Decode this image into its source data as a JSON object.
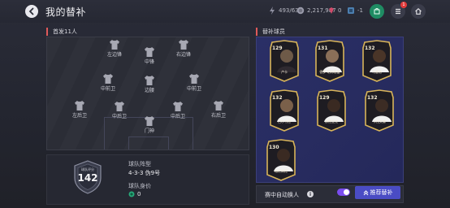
{
  "header": {
    "title": "我的替补",
    "resources": [
      {
        "name": "energy",
        "icon": "bolt-icon",
        "value": "493/63"
      },
      {
        "name": "coins",
        "icon": "coin-icon",
        "value": "2,217,987"
      },
      {
        "name": "gems",
        "icon": "gem-icon",
        "value": "0"
      },
      {
        "name": "fc-points",
        "icon": "fc-points-icon",
        "value": "-1"
      }
    ],
    "notification_count": "1"
  },
  "starting": {
    "title": "首发11人",
    "positions": {
      "lw": "左边锋",
      "st": "中锋",
      "rw": "右边锋",
      "lcm": "中前卫",
      "cdm": "边腰",
      "rcm": "中前卫",
      "lb": "左后卫",
      "lcb": "中后卫",
      "rcb": "中后卫",
      "rb": "右后卫",
      "gk": "门神"
    }
  },
  "team": {
    "rating_label": "球队评分",
    "rating": "142",
    "formation_label": "球队阵型",
    "formation": "4-3-3 伪9号",
    "value_label": "球队身价",
    "value": "0"
  },
  "subs": {
    "title": "替补球员",
    "players": [
      {
        "rating": "129",
        "name": "卢卡"
      },
      {
        "rating": "131",
        "name": "德罗·切林格雷"
      },
      {
        "rating": "132",
        "name": "马塞洛"
      },
      {
        "rating": "132",
        "name": "巴尔韦德"
      },
      {
        "rating": "129",
        "name": "穆德里克"
      },
      {
        "rating": "132",
        "name": "卡拉文森"
      },
      {
        "rating": "130",
        "name": "格伦纳德"
      }
    ],
    "auto_sub_label": "赛中自动换人",
    "auto_sub_enabled": true,
    "recommend_label": "推荐替补"
  },
  "colors": {
    "accent": "#e05a5a",
    "button": "#4a4cc4",
    "toggle": "#7a4cf0",
    "card_gold": "#d8b45a",
    "subs_bg": "#282c60"
  }
}
